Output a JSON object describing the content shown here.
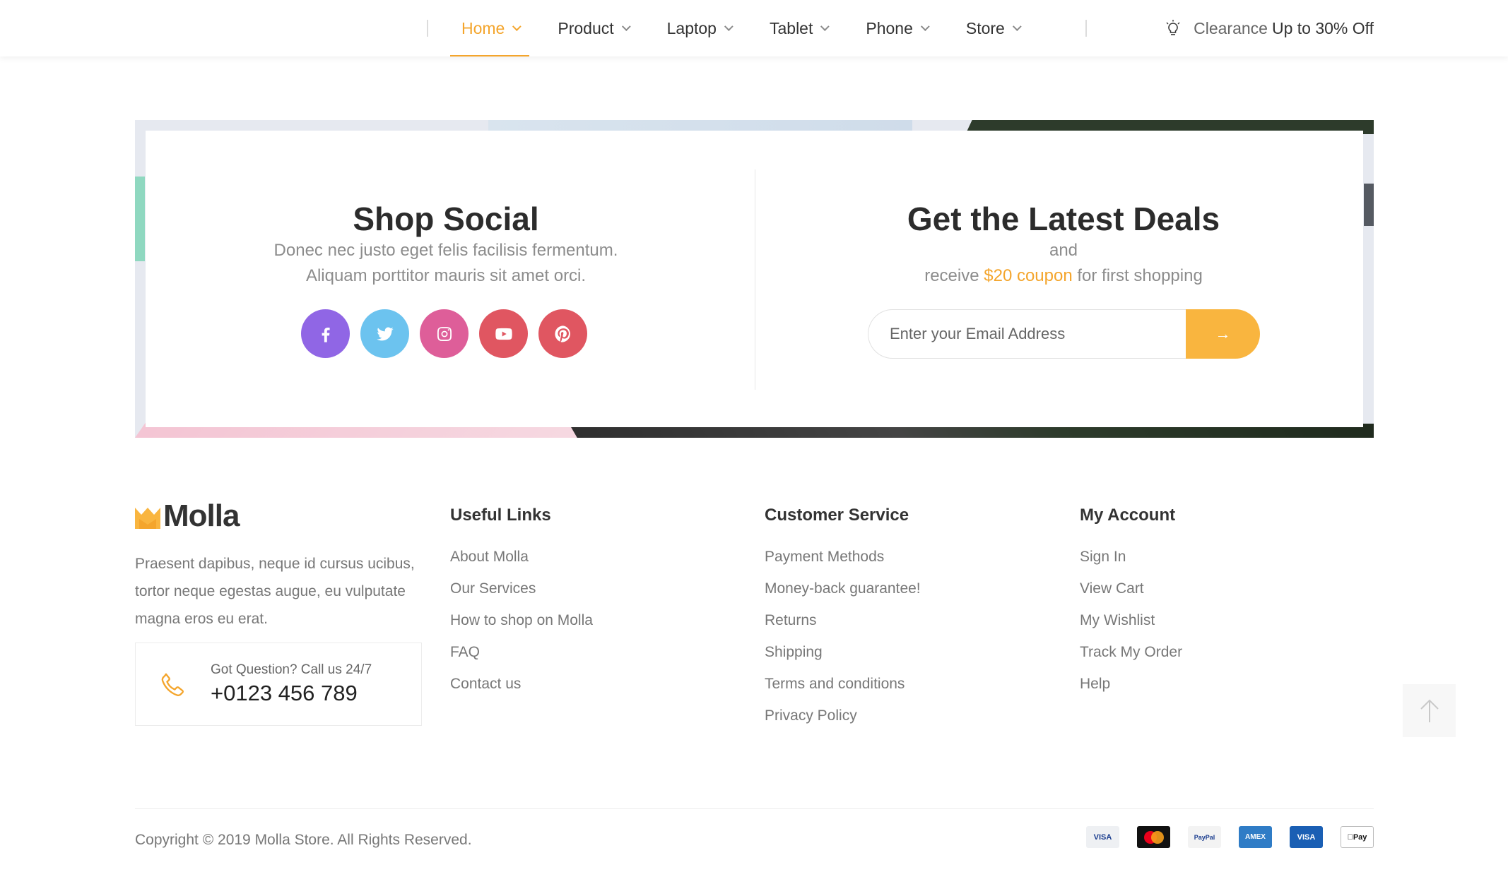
{
  "nav": {
    "items": [
      {
        "label": "Home",
        "active": true
      },
      {
        "label": "Product",
        "active": false
      },
      {
        "label": "Laptop",
        "active": false
      },
      {
        "label": "Tablet",
        "active": false
      },
      {
        "label": "Phone",
        "active": false
      },
      {
        "label": "Store",
        "active": false
      }
    ],
    "promo_prefix": "Clearance",
    "promo_suffix": "Up to 30% Off",
    "promo_icon": "lightbulb-icon"
  },
  "banner": {
    "social": {
      "title": "Shop Social",
      "line1": "Donec nec justo eget felis facilisis fermentum.",
      "line2": "Aliquam porttitor mauris sit amet orci.",
      "icons": [
        {
          "name": "facebook-icon",
          "color": "#9066e5"
        },
        {
          "name": "twitter-icon",
          "color": "#6cc3ef"
        },
        {
          "name": "instagram-icon",
          "color": "#de5e99"
        },
        {
          "name": "youtube-icon",
          "color": "#e05661"
        },
        {
          "name": "pinterest-icon",
          "color": "#e05661"
        }
      ]
    },
    "deals": {
      "title": "Get the Latest Deals",
      "line1": "and",
      "line2_prefix": "receive ",
      "coupon": "$20 coupon",
      "line2_suffix": " for first shopping",
      "email_placeholder": "Enter your Email Address",
      "submit_label": "→"
    }
  },
  "footer": {
    "logo_text": "Molla",
    "about": "Praesent dapibus, neque id cursus ucibus, tortor neque egestas augue, eu vulputate magna eros eu erat.",
    "call_label": "Got Question? Call us 24/7",
    "call_number": "+0123 456 789",
    "columns": [
      {
        "title": "Useful Links",
        "links": [
          "About Molla",
          "Our Services",
          "How to shop on Molla",
          "FAQ",
          "Contact us"
        ]
      },
      {
        "title": "Customer Service",
        "links": [
          "Payment Methods",
          "Money-back guarantee!",
          "Returns",
          "Shipping",
          "Terms and conditions",
          "Privacy Policy"
        ]
      },
      {
        "title": "My Account",
        "links": [
          "Sign In",
          "View Cart",
          "My Wishlist",
          "Track My Order",
          "Help"
        ]
      }
    ],
    "copyright": "Copyright © 2019 Molla Store. All Rights Reserved.",
    "payments": [
      {
        "name": "visa-icon",
        "label": "VISA"
      },
      {
        "name": "mastercard-icon",
        "label": ""
      },
      {
        "name": "paypal-icon",
        "label": "PayPal"
      },
      {
        "name": "amex-icon",
        "label": "AMEX"
      },
      {
        "name": "visa-electron-icon",
        "label": "VISA"
      },
      {
        "name": "apple-pay-icon",
        "label": "Pay"
      }
    ]
  },
  "colors": {
    "accent": "#f4a52c",
    "button": "#f9b53f"
  }
}
